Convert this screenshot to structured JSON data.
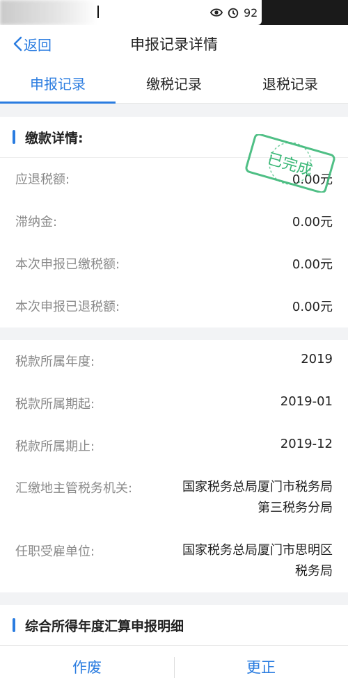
{
  "status_bar": {
    "battery_text": "92"
  },
  "nav": {
    "back_label": "返回",
    "title": "申报记录详情"
  },
  "tabs": [
    {
      "label": "申报记录",
      "active": true
    },
    {
      "label": "缴税记录",
      "active": false
    },
    {
      "label": "退税记录",
      "active": false
    }
  ],
  "payment_details": {
    "section_title": "缴款详情:",
    "stamp_text": "已完成",
    "rows": [
      {
        "label": "应退税额:",
        "value": "0.00元"
      },
      {
        "label": "滞纳金:",
        "value": "0.00元"
      },
      {
        "label": "本次申报已缴税额:",
        "value": "0.00元"
      },
      {
        "label": "本次申报已退税额:",
        "value": "0.00元"
      }
    ]
  },
  "tax_info": {
    "rows": [
      {
        "label": "税款所属年度:",
        "value": "2019"
      },
      {
        "label": "税款所属期起:",
        "value": "2019-01"
      },
      {
        "label": "税款所属期止:",
        "value": "2019-12"
      },
      {
        "label": "汇缴地主管税务机关:",
        "value": "国家税务总局厦门市税务局第三税务分局"
      },
      {
        "label": "任职受雇单位:",
        "value": "国家税务总局厦门市思明区税务局"
      }
    ]
  },
  "annual_section": {
    "title": "综合所得年度汇算申报明细"
  },
  "bottom_bar": {
    "void_label": "作废",
    "correct_label": "更正"
  },
  "colors": {
    "accent": "#2a7ce0",
    "stamp": "#3cb878"
  },
  "icons": {
    "back": "chevron-left-icon",
    "eye": "eye-icon",
    "alarm": "alarm-icon"
  }
}
